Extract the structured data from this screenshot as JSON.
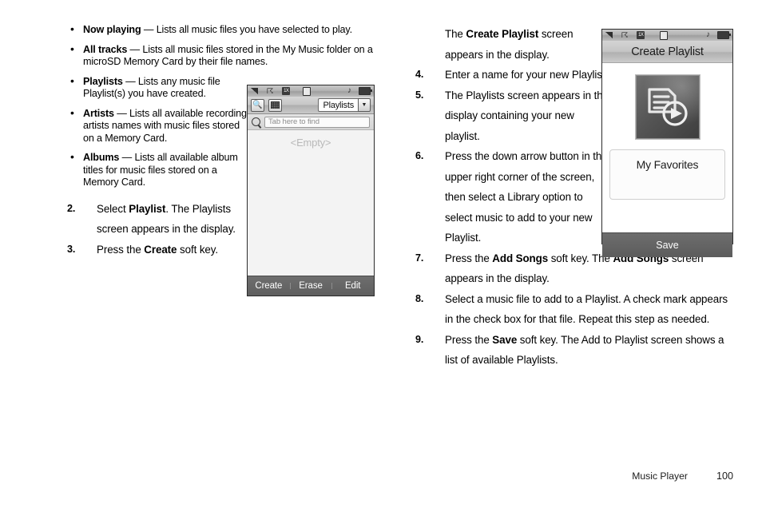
{
  "left_column": {
    "bullets": [
      {
        "term": "Now playing",
        "dash": " — ",
        "desc": "Lists all music files you have selected to play."
      },
      {
        "term": "All tracks",
        "dash": " — ",
        "desc": "Lists all music files stored in the My Music folder on a microSD Memory Card by their file names."
      },
      {
        "term": "Playlists",
        "dash": " — ",
        "desc": "Lists any music file Playlist(s) you have created."
      },
      {
        "term": "Artists",
        "dash": " — ",
        "desc": "Lists all available recording artists names with music files stored on a Memory Card."
      },
      {
        "term": "Albums",
        "dash": " — ",
        "desc": "Lists all available album titles for music files stored on a Memory Card."
      }
    ],
    "steps": [
      {
        "num": "2.",
        "pre": "Select ",
        "bold": "Playlist",
        "post": ". The Playlists screen appears in the display."
      },
      {
        "num": "3.",
        "pre": "Press the ",
        "bold": "Create",
        "post": " soft key."
      }
    ]
  },
  "right_column": {
    "steps": [
      {
        "num": "",
        "pre": "The ",
        "bold": "Create Playlist",
        "post": " screen appears in the display."
      },
      {
        "num": "4.",
        "pre": "Enter a name for your new Playlist.",
        "bold": "",
        "post": ""
      },
      {
        "num": "5.",
        "pre": "The Playlists screen appears in the display containing your new playlist.",
        "bold": "",
        "post": ""
      },
      {
        "num": "6.",
        "pre": "Press the down arrow button in the upper right corner of the screen, then select a Library option to select music to add to your new Playlist.",
        "bold": "",
        "post": ""
      },
      {
        "num": "7.",
        "pre": "Press the ",
        "bold": "Add Songs",
        "post": " soft key. The ",
        "bold2": "Add Songs",
        "post2": " screen appears in the display."
      },
      {
        "num": "8.",
        "pre": "Select a music file to add to a Playlist. A check mark appears in the check box for that file. Repeat this step as needed.",
        "bold": "",
        "post": ""
      },
      {
        "num": "9.",
        "pre": "Press the ",
        "bold": "Save",
        "post": " soft key. The Add to Playlist screen shows a list of available Playlists."
      }
    ]
  },
  "phone_left": {
    "statusbar": {
      "signal": "signal-icon",
      "bluetooth": "bluetooth-off-icon",
      "onex": "1X",
      "message": "message-icon",
      "music": "music-note-icon",
      "battery": "battery-icon"
    },
    "toolbar": {
      "search_button": "search-icon",
      "grid_button": "grid-icon",
      "selected_library": "Playlists",
      "dropdown_arrow": "▼"
    },
    "search": {
      "icon": "magnifier-icon",
      "placeholder": "Tab here to find"
    },
    "body": {
      "empty_text": "<Empty>"
    },
    "softkeys": [
      "Create",
      "Erase",
      "Edit"
    ]
  },
  "phone_right": {
    "statusbar": {
      "signal": "signal-icon",
      "bluetooth": "bluetooth-off-icon",
      "onex": "1X",
      "message": "message-icon",
      "music": "music-note-icon",
      "battery": "battery-icon"
    },
    "title": "Create Playlist",
    "artwork": "playlist-play-icon",
    "playlist_name": "My Favorites",
    "softkey": "Save"
  },
  "footer": {
    "section": "Music Player",
    "page": "100"
  },
  "colors": {
    "text": "#000000",
    "softkey_bg": "#666666",
    "empty_text": "#b9b9b9",
    "placeholder": "#8d8d8d"
  }
}
